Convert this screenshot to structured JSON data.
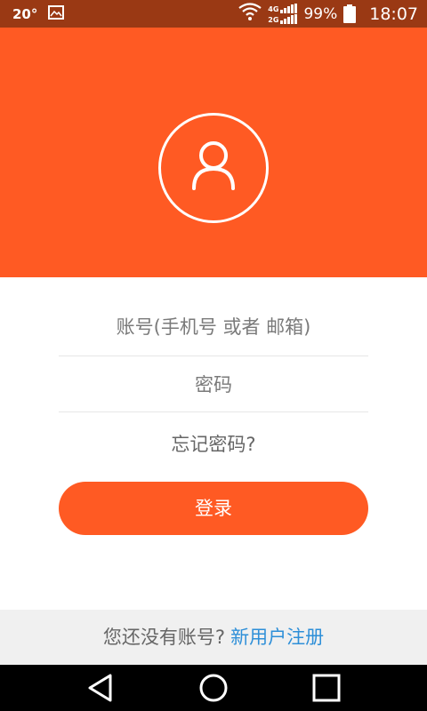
{
  "status_bar": {
    "temperature": "20°",
    "network_top": "4G",
    "network_bottom": "2G",
    "battery": "99%",
    "time": "18:07"
  },
  "colors": {
    "accent": "#ff5a23",
    "status_bar": "#9a3914",
    "link": "#2e8fd8"
  },
  "login": {
    "account_placeholder": "账号(手机号 或者 邮箱)",
    "password_placeholder": "密码",
    "forgot_password": "忘记密码?",
    "login_button": "登录"
  },
  "register": {
    "prompt": "您还没有账号?",
    "link": "新用户注册"
  },
  "icons": [
    "user-icon",
    "image-icon",
    "wifi-icon",
    "back-icon",
    "home-icon",
    "recents-icon"
  ]
}
